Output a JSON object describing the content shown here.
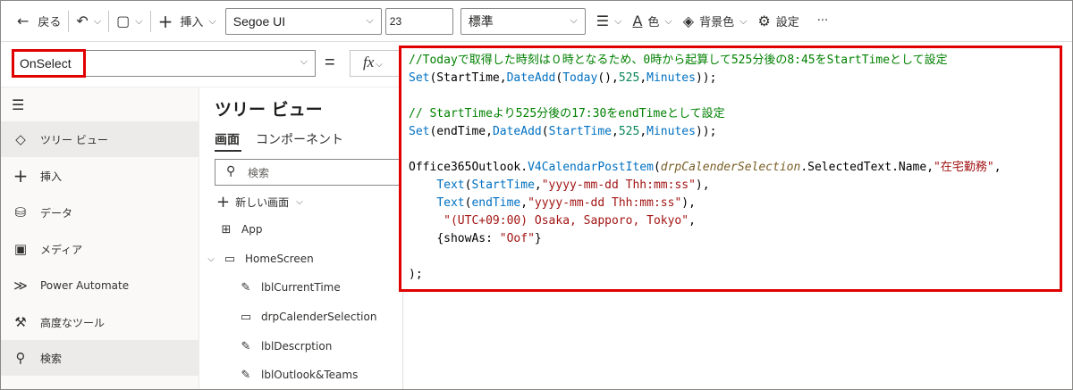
{
  "toolbar": {
    "back_label": "戻る",
    "insert_label": "挿入",
    "font_family": "Segoe UI",
    "font_size": "23",
    "font_weight": "標準",
    "color_label": "色",
    "bg_color_label": "背景色",
    "settings_label": "設定",
    "more_label": "···"
  },
  "formula": {
    "property": "OnSelect",
    "equals": "=",
    "fx_label": "fx"
  },
  "leftnav": {
    "items": [
      {
        "label": "ツリー ビュー",
        "icon": "layers-icon"
      },
      {
        "label": "挿入",
        "icon": "plus-icon"
      },
      {
        "label": "データ",
        "icon": "database-icon"
      },
      {
        "label": "メディア",
        "icon": "media-icon"
      },
      {
        "label": "Power Automate",
        "icon": "power-automate-icon"
      },
      {
        "label": "高度なツール",
        "icon": "tools-icon"
      },
      {
        "label": "検索",
        "icon": "search-icon"
      }
    ]
  },
  "tree": {
    "title": "ツリー ビュー",
    "tab_screens": "画面",
    "tab_components": "コンポーネント",
    "search_placeholder": "検索",
    "new_screen_label": "新しい画面",
    "rows": [
      {
        "label": "App"
      },
      {
        "label": "HomeScreen"
      },
      {
        "label": "lblCurrentTime"
      },
      {
        "label": "drpCalenderSelection"
      },
      {
        "label": "lblDescrption"
      },
      {
        "label": "lblOutlook&Teams"
      }
    ]
  },
  "code": {
    "comment1": "//Todayで取得した時刻は０時となるため、0時から起算して525分後の8:45をStartTimeとして設定",
    "set1_fn": "Set",
    "set1_a": "(StartTime,",
    "set1_fn2": "DateAdd",
    "set1_b": "(",
    "set1_fn3": "Today",
    "set1_c": "(),",
    "set1_num": "525",
    "set1_d": ",",
    "set1_unit": "Minutes",
    "set1_e": "));",
    "comment2": "// StartTimeより525分後の17:30をendTimeとして設定",
    "set2_fn": "Set",
    "set2_a": "(endTime,",
    "set2_fn2": "DateAdd",
    "set2_b": "(",
    "set2_var": "StartTime",
    "set2_c": ",",
    "set2_num": "525",
    "set2_d": ",",
    "set2_unit": "Minutes",
    "set2_e": "));",
    "l_obj": "Office365Outlook.",
    "l_fn": "V4CalendarPostItem",
    "l_b": "(",
    "l_var": "drpCalenderSelection",
    "l_c": ".SelectedText.Name,",
    "l_str": "\"在宅勤務\"",
    "l_d": ",",
    "t1_fn": "Text",
    "t1_a": "(",
    "t1_var": "StartTime",
    "t1_b": ",",
    "t1_str": "\"yyyy-mm-dd Thh:mm:ss\"",
    "t1_c": "),",
    "t2_fn": "Text",
    "t2_a": "(",
    "t2_var": "endTime",
    "t2_b": ",",
    "t2_str": "\"yyyy-mm-dd Thh:mm:ss\"",
    "t2_c": "),",
    "tz_str": "\"(UTC+09:00) Osaka, Sapporo, Tokyo\"",
    "tz_c": ",",
    "show_a": "{showAs: ",
    "show_str": "\"Oof\"",
    "show_b": "}",
    "end": ");"
  },
  "colors": {
    "highlight": "#e00000",
    "comment": "#008000",
    "function": "#0070c1",
    "number": "#098658",
    "string": "#a31515"
  }
}
